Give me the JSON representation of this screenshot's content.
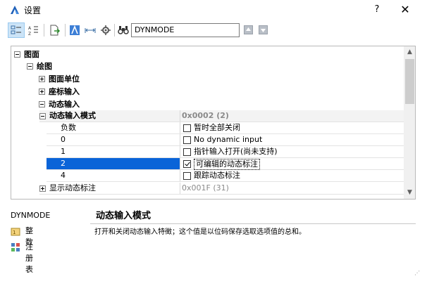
{
  "window": {
    "title": "设置",
    "help_label": "?",
    "close_label": "✕"
  },
  "toolbar": {
    "search_value": "DYNMODE"
  },
  "tree": {
    "root": "图面",
    "group": "绘图",
    "items": [
      "图面单位",
      "座标输入",
      "动态输入"
    ],
    "property_name": "动态输入模式",
    "property_value": "0x0002 (2)",
    "options": [
      {
        "name": "负数",
        "label": "暂时全部关闭",
        "checked": false
      },
      {
        "name": "0",
        "label": "No dynamic input",
        "checked": false
      },
      {
        "name": "1",
        "label": "指针输入打开(尚未支持)",
        "checked": false
      },
      {
        "name": "2",
        "label": "可编辑的动态标注",
        "checked": true
      },
      {
        "name": "4",
        "label": "跟踪动态标注",
        "checked": false
      }
    ],
    "next_property_name": "显示动态标注",
    "next_property_value": "0x001F (31)"
  },
  "info": {
    "variable": "DYNMODE",
    "type_label": "整数",
    "storage_label": "注册表",
    "title": "动态输入模式",
    "description": "打开和关闭动态输入特徵；这个值是以位码保存选取选项值的总和。"
  }
}
